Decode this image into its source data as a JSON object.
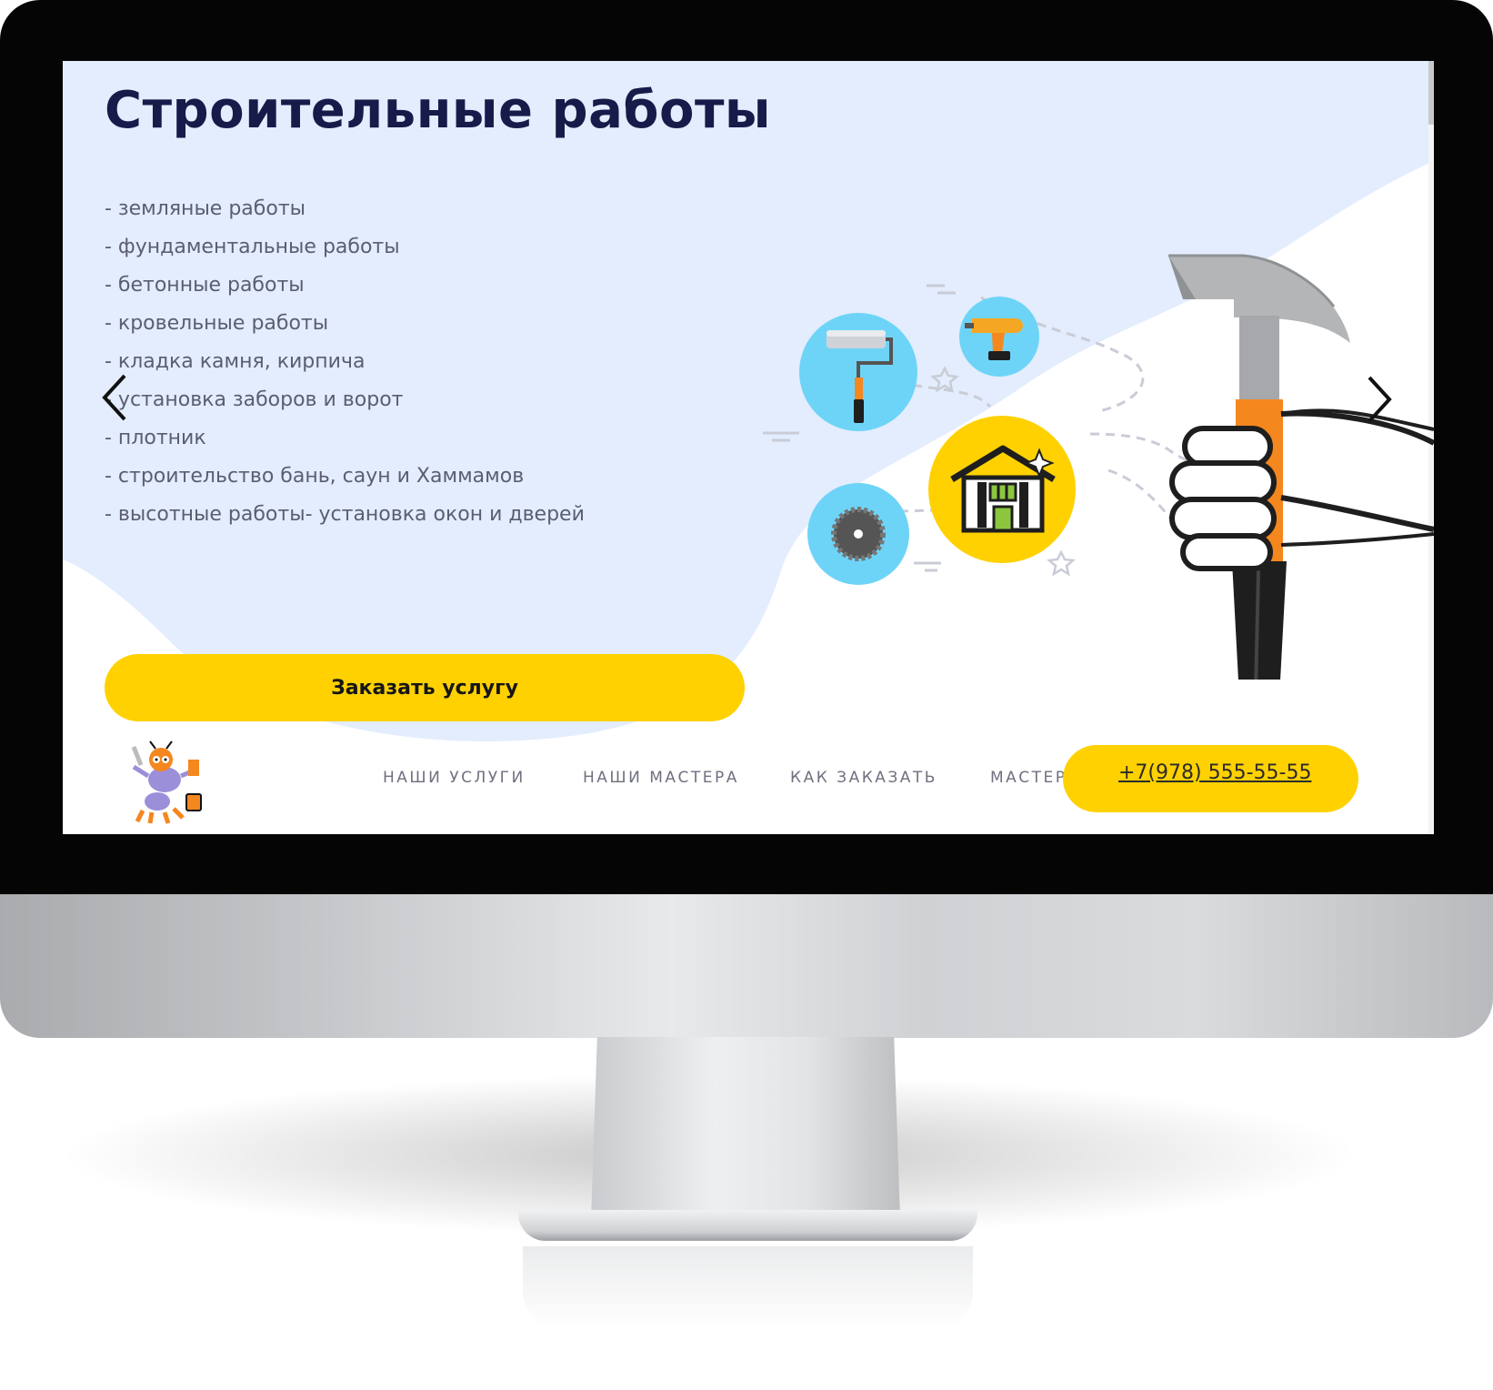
{
  "hero": {
    "title": "Строительные работы",
    "services": [
      "- земляные работы",
      "- фундаментальные работы",
      "- бетонные работы",
      "- кровельные работы",
      "- кладка камня, кирпича",
      "- установка заборов и ворот",
      "- плотник",
      "- строительство бань, саун и Хаммамов",
      "- высотные работы- установка окон и дверей"
    ],
    "order_button": "Заказать услугу"
  },
  "nav": {
    "items": [
      "НАШИ УСЛУГИ",
      "НАШИ МАСТЕРА",
      "КАК ЗАКАЗАТЬ",
      "МАСТЕРАМ"
    ],
    "phone": "+7(978) 555-55-55"
  },
  "icons": {
    "slider_prev": "chevron-left-icon",
    "slider_next": "chevron-right-icon",
    "logo": "ant-handyman-logo",
    "illustration": [
      "paint-roller-icon",
      "drill-icon",
      "house-icon",
      "saw-blade-icon",
      "hammer-in-hand"
    ]
  },
  "colors": {
    "accent": "#ffd100",
    "title": "#161b4a",
    "hero_background": "#e3edfd",
    "text": "#5b5e73",
    "nav_text": "#6f7180",
    "tool_circle": "#6ed4f7",
    "hammer_handle": "#f5871f"
  }
}
